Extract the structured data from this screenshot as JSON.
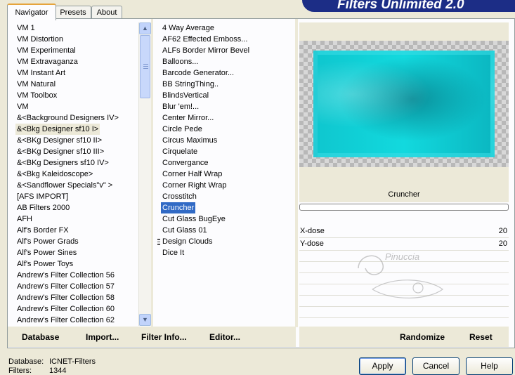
{
  "banner": {
    "title": "Filters Unlimited 2.0"
  },
  "tabs": [
    {
      "label": "Navigator",
      "active": true
    },
    {
      "label": "Presets",
      "active": false
    },
    {
      "label": "About",
      "active": false
    }
  ],
  "categories": {
    "selected_index": 9,
    "items": [
      "VM 1",
      "VM Distortion",
      "VM Experimental",
      "VM Extravaganza",
      "VM Instant Art",
      "VM Natural",
      "VM Toolbox",
      "VM",
      "&<Background Designers IV>",
      "&<Bkg Designer sf10 I>",
      "&<BKg Designer sf10 II>",
      "&<BKg Designer sf10 III>",
      "&<BKg Designers sf10 IV>",
      "&<Bkg Kaleidoscope>",
      "&<Sandflower Specials\"v\" >",
      "[AFS IMPORT]",
      "AB Filters 2000",
      "AFH",
      "Alf's Border FX",
      "Alf's Power Grads",
      "Alf's Power Sines",
      "Alf's Power Toys",
      "Andrew's Filter Collection 56",
      "Andrew's Filter Collection 57",
      "Andrew's Filter Collection 58",
      "Andrew's Filter Collection 60",
      "Andrew's Filter Collection 62"
    ]
  },
  "filters": {
    "selected_index": 16,
    "items": [
      "4 Way Average",
      "AF62 Effected Emboss...",
      "ALFs Border Mirror Bevel",
      "Balloons...",
      "Barcode Generator...",
      "BB StringThing..",
      "BlindsVertical",
      "Blur 'em!...",
      "Center Mirror...",
      "Circle Pede",
      "Circus Maximus",
      "Cirquelate",
      "Convergance",
      "Corner Half Wrap",
      "Corner Right Wrap",
      "Crosstitch",
      "Cruncher",
      "Cut Glass  BugEye",
      "Cut Glass 01",
      "Design Clouds",
      "Dice It"
    ]
  },
  "filter": {
    "name": "Cruncher",
    "progress": 0,
    "params": [
      {
        "label": "X-dose",
        "value": "20"
      },
      {
        "label": "Y-dose",
        "value": "20"
      }
    ]
  },
  "actions": {
    "database": "Database",
    "import": "Import...",
    "filter_info": "Filter Info...",
    "editor": "Editor...",
    "randomize": "Randomize",
    "reset": "Reset"
  },
  "status": {
    "database_label": "Database:",
    "database_value": "ICNET-Filters",
    "filters_label": "Filters:",
    "filters_value": "1344"
  },
  "buttons": {
    "apply": "Apply",
    "cancel": "Cancel",
    "help": "Help"
  },
  "watermark": "Pinuccia",
  "colors": {
    "selection": "#316ac5",
    "banner": "#1c2d86",
    "preview_fill": "#12d9de"
  }
}
